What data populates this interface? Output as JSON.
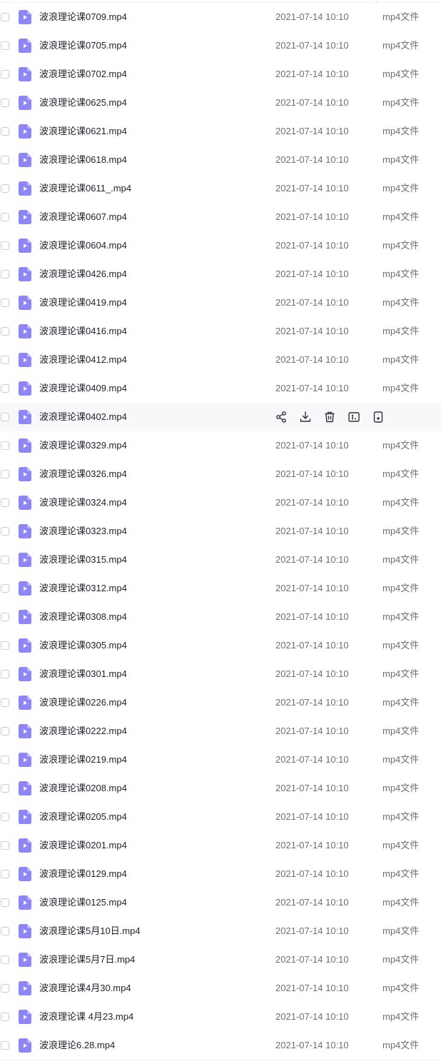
{
  "colors": {
    "file_icon": "#8d86f7",
    "file_icon_fold": "#b9b4fb",
    "text_primary": "#1d2129",
    "text_secondary": "#6b6f7a",
    "hover_row": "#f7f8fa"
  },
  "file_icon_name": "video-file-icon",
  "hover_actions": [
    {
      "name": "share-icon"
    },
    {
      "name": "download-icon"
    },
    {
      "name": "delete-icon"
    },
    {
      "name": "rename-icon"
    },
    {
      "name": "more-icon"
    }
  ],
  "files": [
    {
      "name": "波浪理论课0709.mp4",
      "date": "2021-07-14 10:10",
      "type": "mp4文件"
    },
    {
      "name": "波浪理论课0705.mp4",
      "date": "2021-07-14 10:10",
      "type": "mp4文件"
    },
    {
      "name": "波浪理论课0702.mp4",
      "date": "2021-07-14 10:10",
      "type": "mp4文件"
    },
    {
      "name": "波浪理论课0625.mp4",
      "date": "2021-07-14 10:10",
      "type": "mp4文件"
    },
    {
      "name": "波浪理论课0621.mp4",
      "date": "2021-07-14 10:10",
      "type": "mp4文件"
    },
    {
      "name": "波浪理论课0618.mp4",
      "date": "2021-07-14 10:10",
      "type": "mp4文件"
    },
    {
      "name": "波浪理论课0611_.mp4",
      "date": "2021-07-14 10:10",
      "type": "mp4文件"
    },
    {
      "name": "波浪理论课0607.mp4",
      "date": "2021-07-14 10:10",
      "type": "mp4文件"
    },
    {
      "name": "波浪理论课0604.mp4",
      "date": "2021-07-14 10:10",
      "type": "mp4文件"
    },
    {
      "name": "波浪理论课0426.mp4",
      "date": "2021-07-14 10:10",
      "type": "mp4文件"
    },
    {
      "name": "波浪理论课0419.mp4",
      "date": "2021-07-14 10:10",
      "type": "mp4文件"
    },
    {
      "name": "波浪理论课0416.mp4",
      "date": "2021-07-14 10:10",
      "type": "mp4文件"
    },
    {
      "name": "波浪理论课0412.mp4",
      "date": "2021-07-14 10:10",
      "type": "mp4文件"
    },
    {
      "name": "波浪理论课0409.mp4",
      "date": "2021-07-14 10:10",
      "type": "mp4文件"
    },
    {
      "name": "波浪理论课0402.mp4",
      "date": "",
      "type": "",
      "hovered": true
    },
    {
      "name": "波浪理论课0329.mp4",
      "date": "2021-07-14 10:10",
      "type": "mp4文件"
    },
    {
      "name": "波浪理论课0326.mp4",
      "date": "2021-07-14 10:10",
      "type": "mp4文件"
    },
    {
      "name": "波浪理论课0324.mp4",
      "date": "2021-07-14 10:10",
      "type": "mp4文件"
    },
    {
      "name": "波浪理论课0323.mp4",
      "date": "2021-07-14 10:10",
      "type": "mp4文件"
    },
    {
      "name": "波浪理论课0315.mp4",
      "date": "2021-07-14 10:10",
      "type": "mp4文件"
    },
    {
      "name": "波浪理论课0312.mp4",
      "date": "2021-07-14 10:10",
      "type": "mp4文件"
    },
    {
      "name": "波浪理论课0308.mp4",
      "date": "2021-07-14 10:10",
      "type": "mp4文件"
    },
    {
      "name": "波浪理论课0305.mp4",
      "date": "2021-07-14 10:10",
      "type": "mp4文件"
    },
    {
      "name": "波浪理论课0301.mp4",
      "date": "2021-07-14 10:10",
      "type": "mp4文件"
    },
    {
      "name": "波浪理论课0226.mp4",
      "date": "2021-07-14 10:10",
      "type": "mp4文件"
    },
    {
      "name": "波浪理论课0222.mp4",
      "date": "2021-07-14 10:10",
      "type": "mp4文件"
    },
    {
      "name": "波浪理论课0219.mp4",
      "date": "2021-07-14 10:10",
      "type": "mp4文件"
    },
    {
      "name": "波浪理论课0208.mp4",
      "date": "2021-07-14 10:10",
      "type": "mp4文件"
    },
    {
      "name": "波浪理论课0205.mp4",
      "date": "2021-07-14 10:10",
      "type": "mp4文件"
    },
    {
      "name": "波浪理论课0201.mp4",
      "date": "2021-07-14 10:10",
      "type": "mp4文件"
    },
    {
      "name": "波浪理论课0129.mp4",
      "date": "2021-07-14 10:10",
      "type": "mp4文件"
    },
    {
      "name": "波浪理论课0125.mp4",
      "date": "2021-07-14 10:10",
      "type": "mp4文件"
    },
    {
      "name": "波浪理论课5月10日.mp4",
      "date": "2021-07-14 10:10",
      "type": "mp4文件"
    },
    {
      "name": "波浪理论课5月7日.mp4",
      "date": "2021-07-14 10:10",
      "type": "mp4文件"
    },
    {
      "name": "波浪理论课4月30.mp4",
      "date": "2021-07-14 10:10",
      "type": "mp4文件"
    },
    {
      "name": "波浪理论课 4月23.mp4",
      "date": "2021-07-14 10:10",
      "type": "mp4文件"
    },
    {
      "name": "波浪理论6.28.mp4",
      "date": "2021-07-14 10:10",
      "type": "mp4文件"
    }
  ]
}
